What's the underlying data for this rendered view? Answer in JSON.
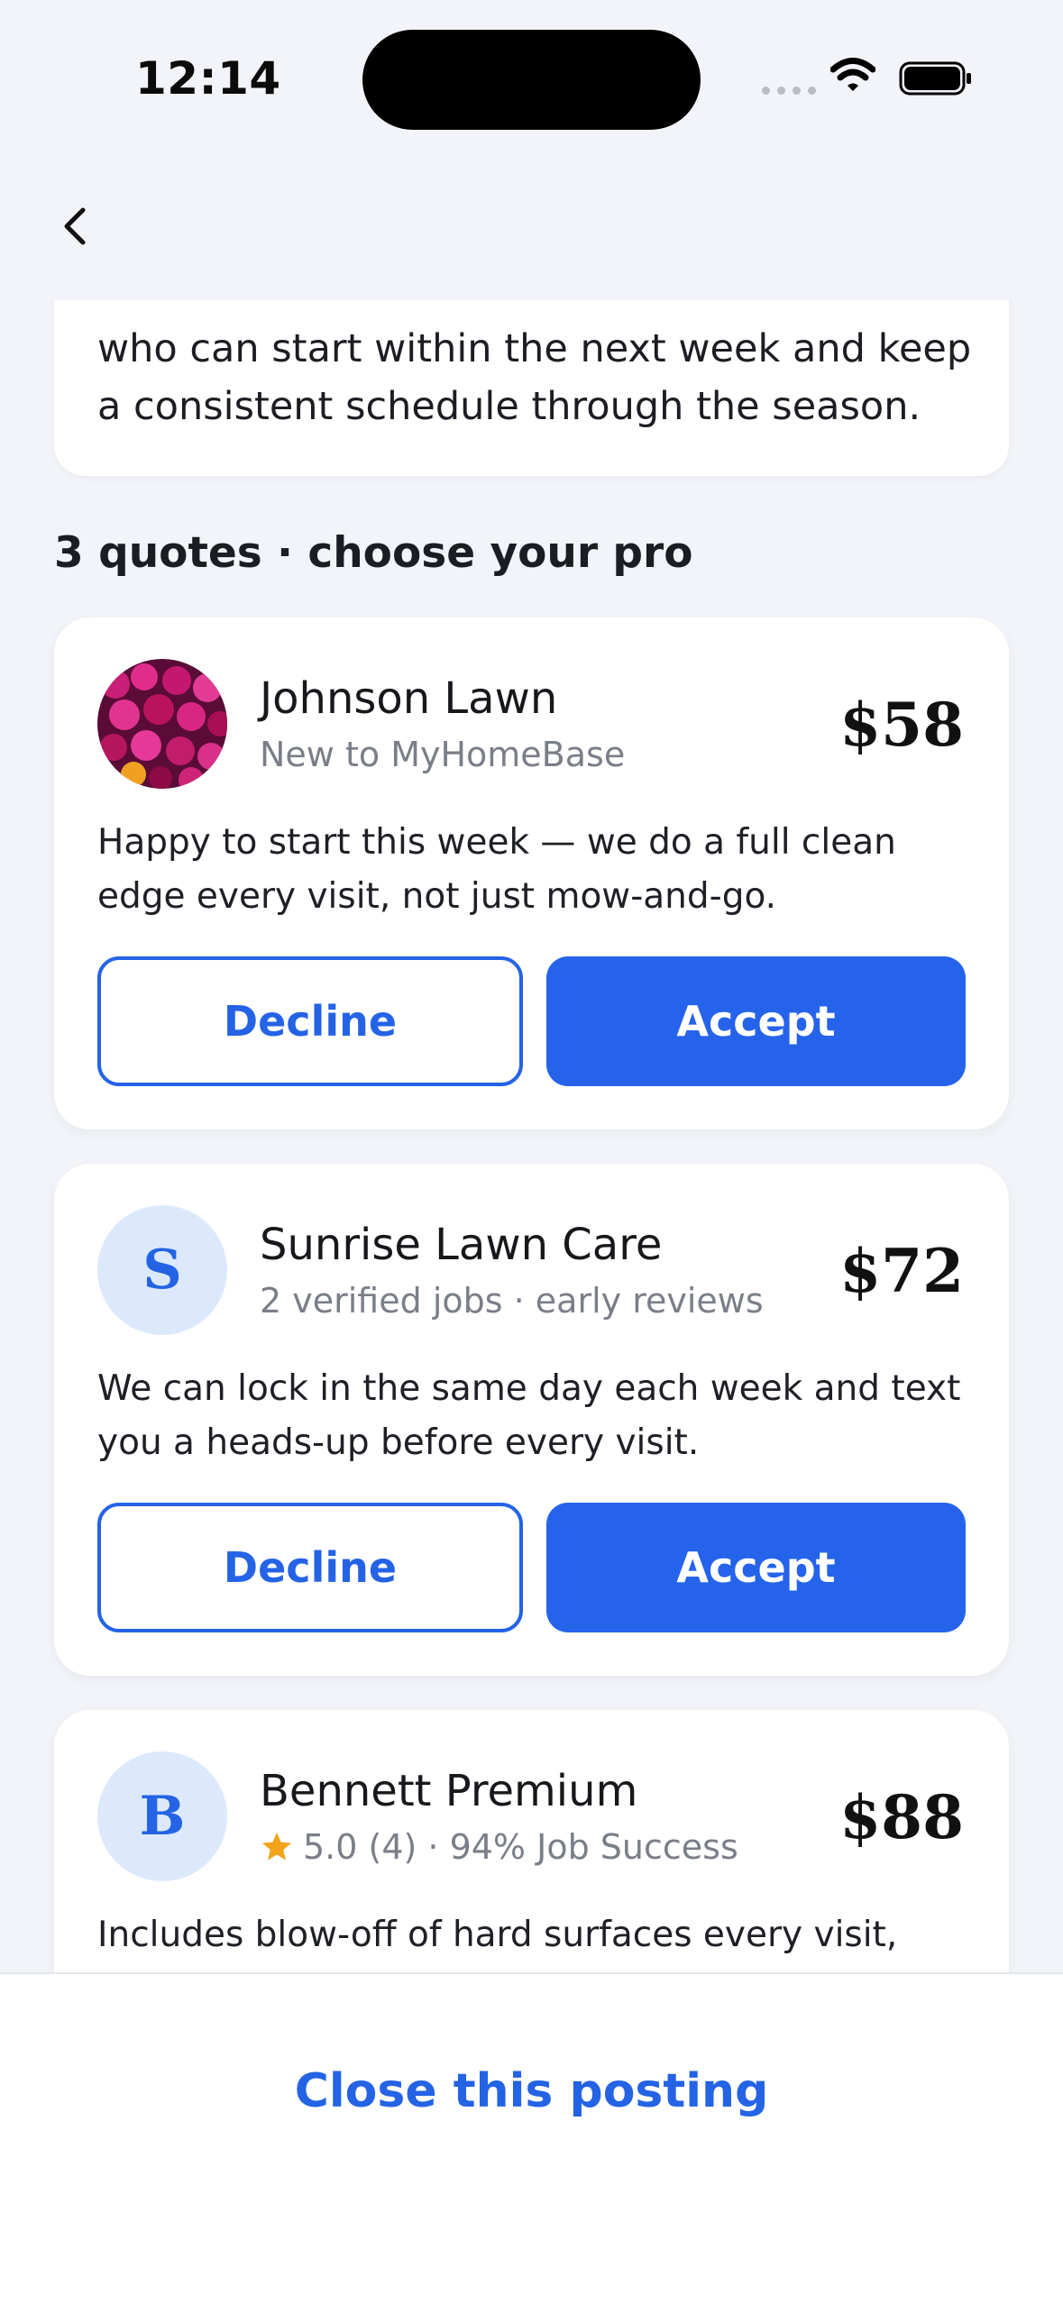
{
  "status_bar": {
    "time": "12:14"
  },
  "intro": {
    "text": "who can start within the next week and keep a consistent schedule through the season."
  },
  "section": {
    "title": "3 quotes · choose your pro"
  },
  "quotes": [
    {
      "name": "Johnson Lawn",
      "meta": "New to MyHomeBase",
      "price": "$58",
      "message": "Happy to start this week — we do a full clean edge every visit, not just mow-and-go.",
      "decline_label": "Decline",
      "accept_label": "Accept",
      "avatar": "flower-photo"
    },
    {
      "name": "Sunrise Lawn Care",
      "meta": "2 verified jobs · early reviews",
      "price": "$72",
      "message": "We can lock in the same day each week and text you a heads-up before every visit.",
      "decline_label": "Decline",
      "accept_label": "Accept",
      "avatar_letter": "S"
    },
    {
      "name": "Bennett Premium",
      "meta": "5.0 (4) · 94% Job Success",
      "price": "$88",
      "message": "Includes blow-off of hard surfaces every visit, plus",
      "avatar_letter": "B",
      "rating_icon": "star-icon"
    }
  ],
  "footer": {
    "close_label": "Close this posting"
  },
  "colors": {
    "accent": "#2563eb",
    "background": "#f2f4f9",
    "star": "#f2a31b"
  }
}
